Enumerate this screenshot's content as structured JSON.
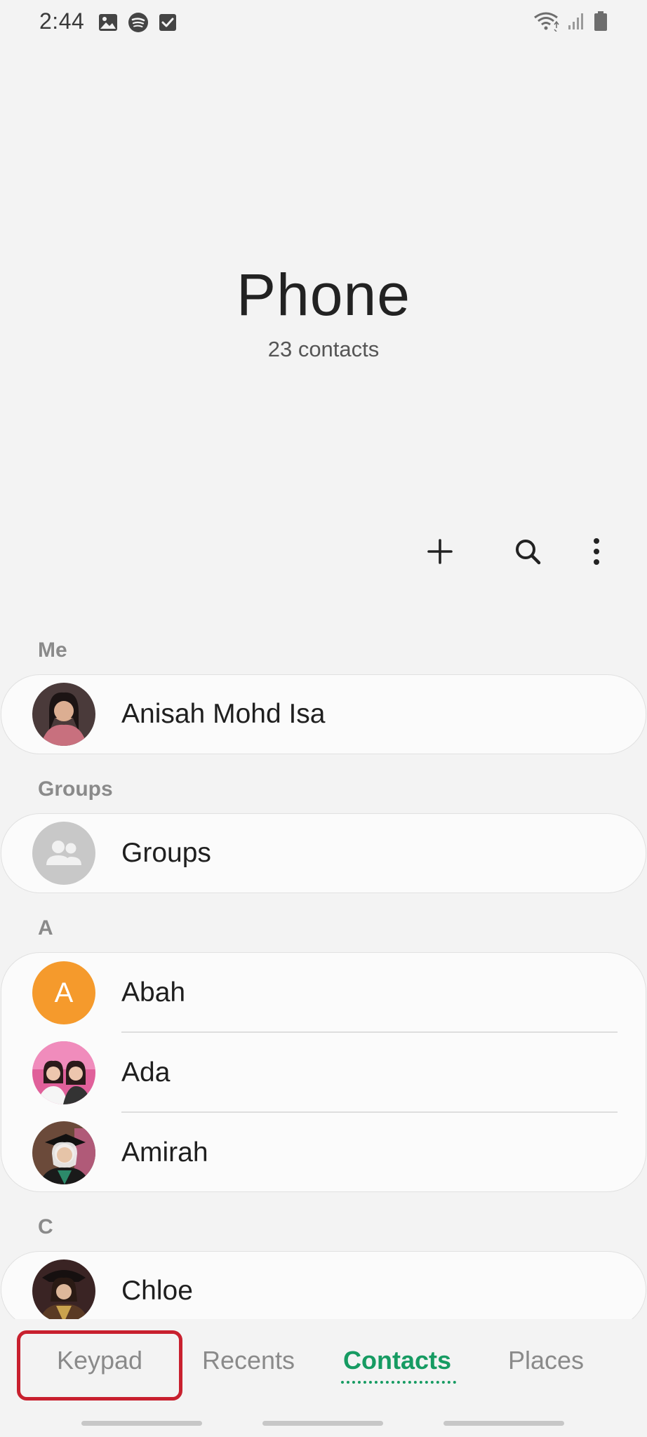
{
  "status_bar": {
    "time": "2:44",
    "left_icons": [
      "image-icon",
      "spotify-icon",
      "checkbox-icon"
    ],
    "right_icons": [
      "wifi-icon",
      "signal-icon",
      "battery-icon"
    ]
  },
  "header": {
    "title": "Phone",
    "subtitle": "23 contacts"
  },
  "toolbar": {
    "icons": [
      "add-icon",
      "search-icon",
      "more-vert-icon"
    ]
  },
  "sections": {
    "me": {
      "label": "Me",
      "contacts": [
        {
          "name": "Anisah Mohd Isa",
          "avatar": "photo"
        }
      ]
    },
    "groups": {
      "label": "Groups",
      "contacts": [
        {
          "name": "Groups",
          "avatar": "groups-icon"
        }
      ]
    },
    "a": {
      "label": "A",
      "contacts": [
        {
          "name": "Abah",
          "avatar_letter": "A",
          "avatar_color": "#f59a2c"
        },
        {
          "name": "Ada",
          "avatar": "photo"
        },
        {
          "name": "Amirah",
          "avatar": "photo"
        }
      ]
    },
    "c": {
      "label": "C",
      "contacts": [
        {
          "name": "Chloe",
          "avatar": "photo"
        }
      ]
    }
  },
  "tabs": {
    "keypad": "Keypad",
    "recents": "Recents",
    "contacts": "Contacts",
    "places": "Places",
    "active": "Contacts",
    "active_color": "#169b62",
    "highlight_color": "#c8202e"
  }
}
